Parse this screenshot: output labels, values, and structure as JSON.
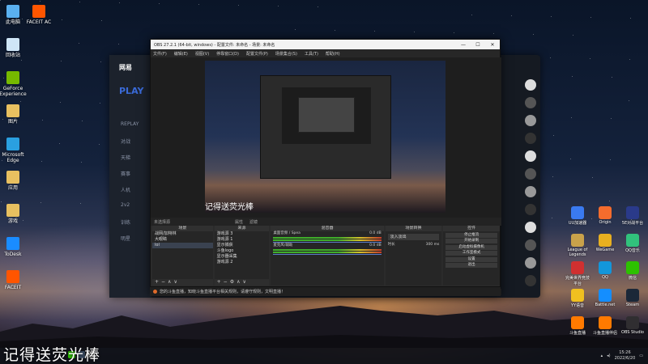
{
  "desktop": {
    "left_icons": [
      {
        "label": "此电脑",
        "icon": "computer-icon",
        "color": "#5ab0f0"
      },
      {
        "label": "回收站",
        "icon": "recycle-bin-icon",
        "color": "#cfe6f7"
      },
      {
        "label": "GeForce Experience",
        "icon": "nvidia-icon",
        "color": "#76b900"
      },
      {
        "label": "图片",
        "icon": "folder-icon",
        "color": "#e8c060"
      },
      {
        "label": "Microsoft Edge",
        "icon": "edge-icon",
        "color": "#2aa0e0"
      },
      {
        "label": "应用",
        "icon": "folder-icon",
        "color": "#e8c060"
      },
      {
        "label": "游戏",
        "icon": "folder-icon",
        "color": "#e8c060"
      },
      {
        "label": "ToDesk",
        "icon": "todesk-icon",
        "color": "#1a8cff"
      },
      {
        "label": "FACEIT",
        "icon": "faceit-icon",
        "color": "#ff5500"
      }
    ],
    "second_column_icon": {
      "label": "FACEIT AC",
      "icon": "faceit-icon",
      "color": "#ff5500"
    },
    "right_icons": [
      {
        "label": "UU加速器",
        "icon": "uu-icon",
        "color": "#3a7af0"
      },
      {
        "label": "Origin",
        "icon": "origin-icon",
        "color": "#f56c2d"
      },
      {
        "label": "5E对战平台",
        "icon": "5e-icon",
        "color": "#2a3a8a"
      },
      {
        "label": "League of Legends",
        "icon": "lol-icon",
        "color": "#c9a24a"
      },
      {
        "label": "WeGame",
        "icon": "wegame-icon",
        "color": "#e8b020"
      },
      {
        "label": "QQ音乐",
        "icon": "qqmusic-icon",
        "color": "#31c27c"
      },
      {
        "label": "完美世界竞技平台",
        "icon": "perfect-icon",
        "color": "#d03030"
      },
      {
        "label": "QQ",
        "icon": "qq-icon",
        "color": "#1296db"
      },
      {
        "label": "微信",
        "icon": "wechat-icon",
        "color": "#2dc100"
      },
      {
        "label": "YY语音",
        "icon": "yy-icon",
        "color": "#f0c020"
      },
      {
        "label": "Battle.net",
        "icon": "battlenet-icon",
        "color": "#148eff"
      },
      {
        "label": "Steam",
        "icon": "steam-icon",
        "color": "#1b2838"
      },
      {
        "label": "斗鱼直播",
        "icon": "douyu-icon",
        "color": "#ff7a00"
      },
      {
        "label": "斗鱼直播伴侣",
        "icon": "douyu-icon",
        "color": "#ff7a00"
      },
      {
        "label": "OBS Studio",
        "icon": "obs-icon",
        "color": "#302e31"
      }
    ]
  },
  "behind_app": {
    "brand": "网易",
    "play_label": "PLAY",
    "sidebar_tags": [
      "REPLAY",
      "对战",
      "天梯",
      "赛事",
      "人机",
      "2v2",
      "训练",
      "明星"
    ]
  },
  "obs": {
    "title": "OBS 27.2.1 (64-bit, windows) - 配置文件: 未命名 - 场景: 未命名",
    "menu": [
      "文件(F)",
      "编辑(E)",
      "视图(V)",
      "停靠窗口(D)",
      "配置文件(P)",
      "场景集合(S)",
      "工具(T)",
      "帮助(H)"
    ],
    "preview_watermark": "记得送荧光棒",
    "toolbar_label": "未选择源",
    "toolbar_toggles": [
      "属性",
      "滤镜"
    ],
    "scenes": {
      "header": "场景",
      "items": [
        "战网/加特林",
        "大眼睛",
        "lol"
      ],
      "selected": 2
    },
    "sources": {
      "header": "来源",
      "items": [
        "游戏源 3",
        "游戏源 1",
        "显示捕获",
        "斗鱼logo",
        "显示器采集",
        "游戏源 2"
      ]
    },
    "mixer": {
      "header": "混音器",
      "channels": [
        {
          "name": "桌面音频 / Spea",
          "db": "0.0 dB"
        },
        {
          "name": "麦克风/辅助",
          "db": "0.0 dB"
        }
      ]
    },
    "transitions": {
      "header": "场景转换",
      "selected": "淡入淡出",
      "duration_label": "时长",
      "duration": "300 ms"
    },
    "controls": {
      "header": "控件",
      "buttons": [
        "停止推流",
        "开始录制",
        "启动虚拟摄像机",
        "工作室模式",
        "设置",
        "退出"
      ]
    },
    "status": {
      "live": "LIVE: 00:00:00",
      "rec": "REC: 00:00:00",
      "cpu": "CPU: 0.7%, 60.00 fps",
      "dropped": "12%"
    },
    "notice": "您的斗鱼直播，知晓斗鱼直播平台相关规则，请遵守规则，文明直播！"
  },
  "watermark": "记得送荧光棒",
  "tray": {
    "time": "15:26",
    "date": "2022/6/20"
  }
}
